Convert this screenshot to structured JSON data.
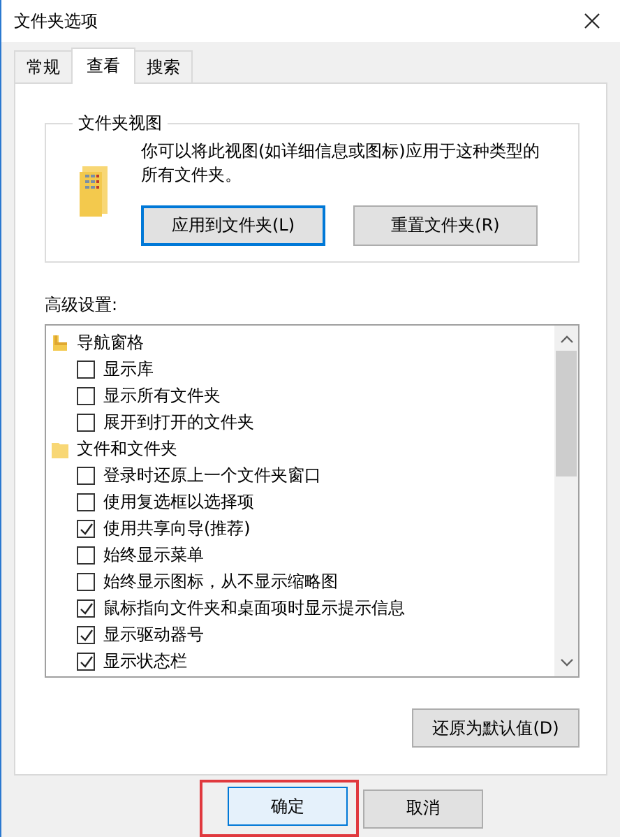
{
  "window": {
    "title": "文件夹选项"
  },
  "tabs": [
    {
      "label": "常规",
      "selected": false
    },
    {
      "label": "查看",
      "selected": true
    },
    {
      "label": "搜索",
      "selected": false
    }
  ],
  "folder_views": {
    "title": "文件夹视图",
    "description": "你可以将此视图(如详细信息或图标)应用于这种类型的所有文件夹。",
    "buttons": [
      {
        "label": "应用到文件夹(L)",
        "focused": true
      },
      {
        "label": "重置文件夹(R)",
        "focused": false
      }
    ]
  },
  "advanced": {
    "label": "高级设置:",
    "items": [
      {
        "kind": "pane",
        "label": "导航窗格",
        "children": [
          {
            "kind": "checkbox",
            "label": "显示库",
            "checked": false
          },
          {
            "kind": "checkbox",
            "label": "显示所有文件夹",
            "checked": false
          },
          {
            "kind": "checkbox",
            "label": "展开到打开的文件夹",
            "checked": false
          }
        ]
      },
      {
        "kind": "folder",
        "label": "文件和文件夹",
        "children": [
          {
            "kind": "checkbox",
            "label": "登录时还原上一个文件夹窗口",
            "checked": false
          },
          {
            "kind": "checkbox",
            "label": "使用复选框以选择项",
            "checked": false
          },
          {
            "kind": "checkbox",
            "label": "使用共享向导(推荐)",
            "checked": true
          },
          {
            "kind": "checkbox",
            "label": "始终显示菜单",
            "checked": false
          },
          {
            "kind": "checkbox",
            "label": "始终显示图标，从不显示缩略图",
            "checked": false
          },
          {
            "kind": "checkbox",
            "label": "鼠标指向文件夹和桌面项时显示提示信息",
            "checked": true
          },
          {
            "kind": "checkbox",
            "label": "显示驱动器号",
            "checked": true
          },
          {
            "kind": "checkbox",
            "label": "显示状态栏",
            "checked": true
          }
        ]
      }
    ],
    "restore_button": "还原为默认值(D)"
  },
  "buttons": [
    {
      "label": "确定",
      "highlighted": true
    },
    {
      "label": "取消",
      "highlighted": false
    }
  ]
}
